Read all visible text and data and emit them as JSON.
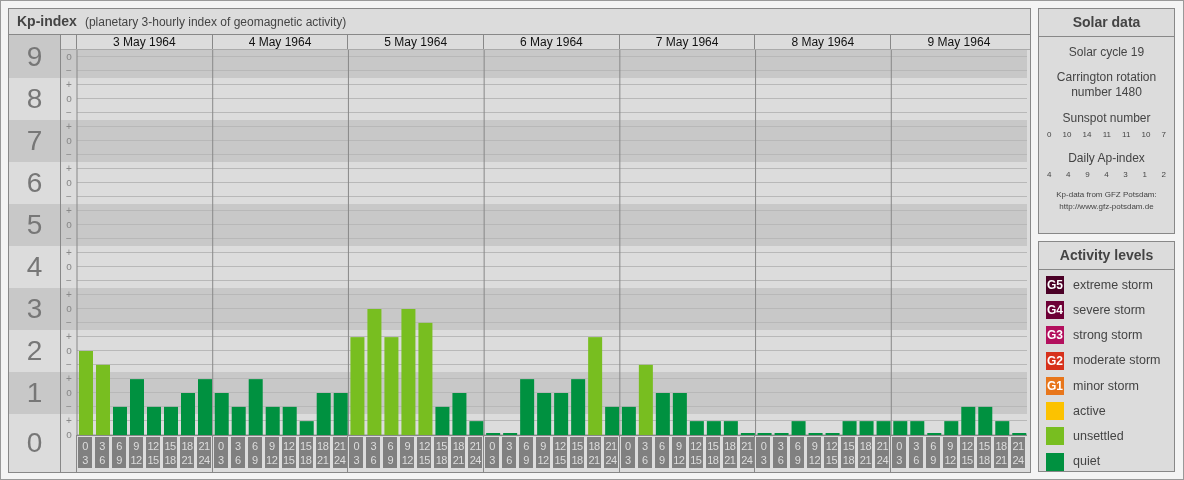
{
  "title": {
    "main": "Kp-index",
    "subtitle": "(planetary 3-hourly index of geomagnetic activity)"
  },
  "chart": {
    "day_labels": [
      "3 May 1964",
      "4 May 1964",
      "5 May 1964",
      "6 May 1964",
      "7 May 1964",
      "8 May 1964",
      "9 May 1964"
    ],
    "sublevel_marks": [
      "o",
      "−",
      "+",
      "o",
      "−",
      "+",
      "o",
      "−",
      "+",
      "o",
      "−",
      "+",
      "o",
      "−",
      "+",
      "o",
      "−",
      "+",
      "o",
      "−",
      "+",
      "o",
      "−",
      "+",
      "o",
      "−",
      "+",
      "o"
    ],
    "chart_data": {
      "type": "bar",
      "stacked": true,
      "grid": true,
      "ylim": [
        0,
        9
      ],
      "bands": [
        {
          "axis": "y",
          "from": 8.5,
          "to": 9.17
        },
        {
          "axis": "y",
          "from": 6.5,
          "to": 7.5
        },
        {
          "axis": "y",
          "from": 4.5,
          "to": 5.5
        },
        {
          "axis": "y",
          "from": 2.5,
          "to": 3.5
        },
        {
          "axis": "y",
          "from": 0.5,
          "to": 1.5
        }
      ],
      "yticks": [
        {
          "value": 9,
          "label": "9"
        },
        {
          "value": 8,
          "label": "8"
        },
        {
          "value": 7,
          "label": "7"
        },
        {
          "value": 6,
          "label": "6"
        },
        {
          "value": 5,
          "label": "5"
        },
        {
          "value": 4,
          "label": "4"
        },
        {
          "value": 3,
          "label": "3"
        },
        {
          "value": 2,
          "label": "2"
        },
        {
          "value": 1,
          "label": "1"
        },
        {
          "value": 0,
          "label": "0"
        }
      ],
      "categories": [
        "0\n3",
        "3\n6",
        "6\n9",
        "9\n12",
        "12\n15",
        "15\n18",
        "18\n21",
        "21\n24",
        "0\n3",
        "3\n6",
        "6\n9",
        "9\n12",
        "12\n15",
        "15\n18",
        "18\n21",
        "21\n24",
        "0\n3",
        "3\n6",
        "6\n9",
        "9\n12",
        "12\n15",
        "15\n18",
        "18\n21",
        "21\n24",
        "0\n3",
        "3\n6",
        "6\n9",
        "9\n12",
        "12\n15",
        "15\n18",
        "18\n21",
        "21\n24",
        "0\n3",
        "3\n6",
        "6\n9",
        "9\n12",
        "12\n15",
        "15\n18",
        "18\n21",
        "21\n24",
        "0\n3",
        "3\n6",
        "6\n9",
        "9\n12",
        "12\n15",
        "15\n18",
        "18\n21",
        "21\n24",
        "0\n3",
        "3\n6",
        "6\n9",
        "9\n12",
        "12\n15",
        "15\n18",
        "18\n21",
        "21\n24"
      ],
      "series": [
        {
          "color": "#009140",
          "values": [
            null,
            null,
            0.67,
            1.33,
            0.67,
            0.67,
            1,
            1.33,
            1,
            0.67,
            1.33,
            0.67,
            0.67,
            0.33,
            1,
            1,
            null,
            null,
            null,
            null,
            null,
            0.67,
            1,
            0.33,
            0,
            0,
            1.33,
            1,
            1,
            1.33,
            null,
            0.67,
            0.67,
            null,
            1,
            1,
            0.33,
            0.33,
            0.33,
            0,
            0,
            0,
            0.33,
            0,
            0,
            0.33,
            0.33,
            0.33,
            0.33,
            0.33,
            0,
            0.33,
            0.67,
            0.67,
            0.33,
            0
          ]
        },
        {
          "color": "#78be20",
          "values": [
            2,
            1.67,
            null,
            null,
            null,
            null,
            null,
            null,
            null,
            null,
            null,
            null,
            null,
            null,
            null,
            null,
            2.33,
            3,
            2.33,
            3,
            2.67,
            null,
            null,
            null,
            null,
            null,
            null,
            null,
            null,
            null,
            2.33,
            null,
            null,
            1.67,
            null,
            null,
            null,
            null,
            null,
            null,
            null,
            null,
            null,
            null,
            null,
            null,
            null,
            null,
            null,
            null,
            null,
            null,
            null,
            null,
            null,
            null
          ]
        }
      ]
    }
  },
  "solar_data": {
    "title": "Solar data",
    "cycle": "Solar cycle 19",
    "rotation": "Carrington rotation number 1480",
    "sunspot_label": "Sunspot number",
    "sunspot_numbers": [
      "0",
      "10",
      "14",
      "11",
      "11",
      "10",
      "7"
    ],
    "ap_label": "Daily Ap-index",
    "ap_values": [
      "4",
      "4",
      "9",
      "4",
      "3",
      "1",
      "2"
    ],
    "source": "Kp-data from GFZ Potsdam:",
    "source_url": "http://www.gfz-potsdam.de"
  },
  "activity_levels": {
    "title": "Activity levels",
    "items": [
      {
        "badge": "G5",
        "label": "extreme storm",
        "color": "#4a0026"
      },
      {
        "badge": "G4",
        "label": "severe storm",
        "color": "#6e0036"
      },
      {
        "badge": "G3",
        "label": "strong storm",
        "color": "#b3105e"
      },
      {
        "badge": "G2",
        "label": "moderate storm",
        "color": "#d7311b"
      },
      {
        "badge": "G1",
        "label": "minor storm",
        "color": "#e8761b"
      },
      {
        "label": "active",
        "color": "#fcc200"
      },
      {
        "label": "unsettled",
        "color": "#78be20"
      },
      {
        "label": "quiet",
        "color": "#009140"
      }
    ]
  }
}
